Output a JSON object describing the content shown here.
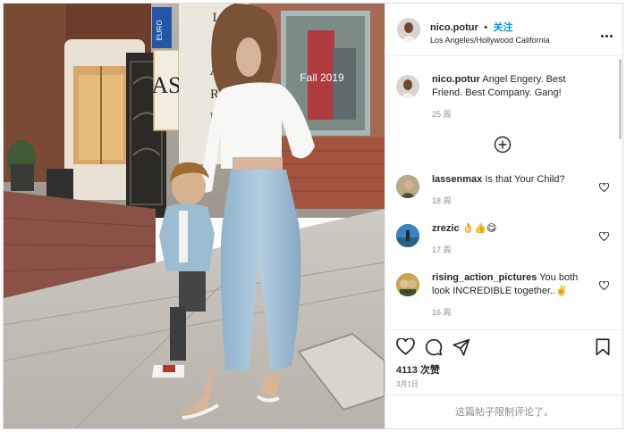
{
  "post": {
    "photo_alt": "Woman and child walking on sidewalk",
    "storefront_sign_letters": [
      "I",
      "A",
      "R",
      "D"
    ],
    "euro_sign": "EURO",
    "fall_sign": "Fall 2019"
  },
  "header": {
    "username": "nico.potur",
    "separator": "•",
    "follow_label": "关注",
    "location": "Los Angeles/Hollywood California",
    "more_icon": "more-dots-icon"
  },
  "caption": {
    "username": "nico.potur",
    "text": "Angel Engery. Best Friend. Best Company. Gang!",
    "time": "25 周"
  },
  "load_more_icon": "plus-circle-icon",
  "comments": [
    {
      "username": "lassenmax",
      "text": "Is that Your Child?",
      "time": "18 周"
    },
    {
      "username": "zrezic",
      "text": "👌👍😋",
      "time": "17 周"
    },
    {
      "username": "rising_action_pictures",
      "text": "You both look INCREDIBLE together..✌️",
      "time": "16 周"
    }
  ],
  "actions": {
    "like_icon": "heart-icon",
    "comment_icon": "comment-icon",
    "share_icon": "share-icon",
    "save_icon": "bookmark-icon",
    "likes_label": "4113 次赞",
    "date": "3月1日"
  },
  "comments_limited": "这篇帖子限制评论了。"
}
